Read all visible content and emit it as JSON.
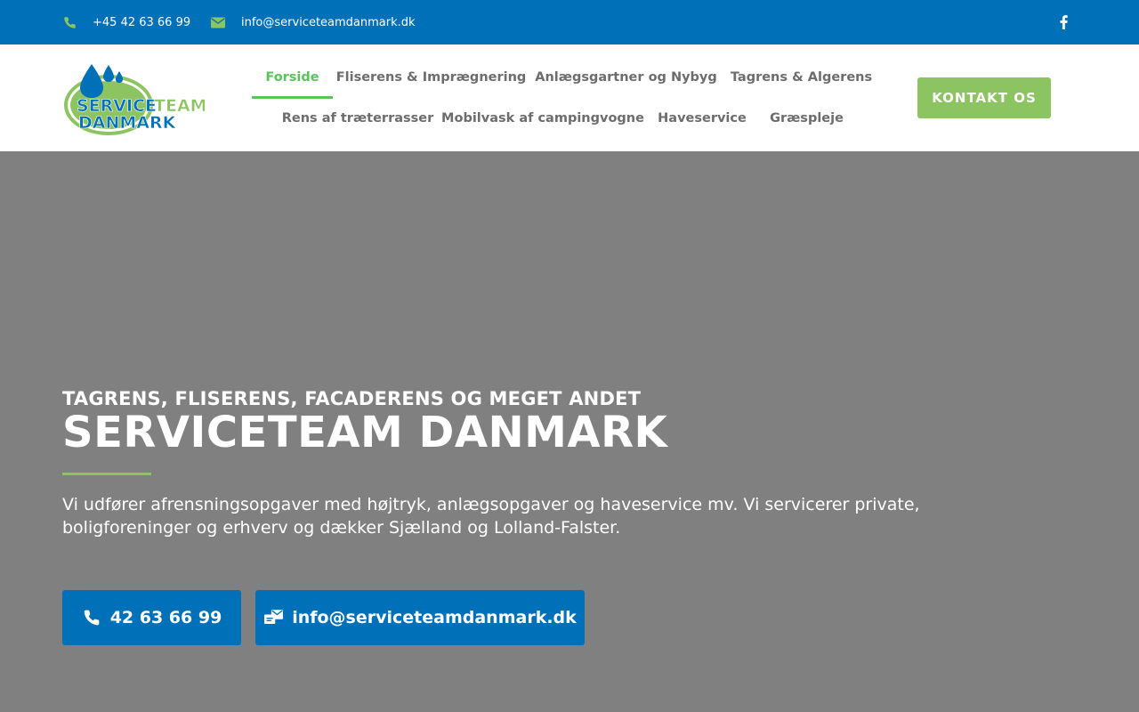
{
  "topbar": {
    "phone": "+45 42 63 66 99",
    "email": "info@serviceteamdanmark.dk",
    "phone_icon": "phone-icon",
    "email_icon": "envelope-icon",
    "social_icon": "facebook-icon"
  },
  "logo": {
    "line1_a": "SERVICE",
    "line1_b": "TEAM",
    "line2": "DANMARK"
  },
  "nav": {
    "items": [
      {
        "label": "Forside",
        "active": true
      },
      {
        "label": "Fliserens & Imprægnering",
        "active": false
      },
      {
        "label": "Anlægsgartner og Nybyg",
        "active": false
      },
      {
        "label": "Tagrens & Algerens",
        "active": false
      },
      {
        "label": "Rens af træterrasser",
        "active": false
      },
      {
        "label": "Mobilvask af campingvogne",
        "active": false
      },
      {
        "label": "Haveservice",
        "active": false
      },
      {
        "label": "Græspleje",
        "active": false
      }
    ],
    "cta_label": "KONTAKT OS"
  },
  "hero": {
    "subtitle": "TAGRENS, FLISERENS, FACADERENS OG MEGET ANDET",
    "title": "SERVICETEAM DANMARK",
    "description": "Vi udfører afrensningsopgaver med højtryk, anlægsopgaver og haveservice mv. Vi servicerer private, boligforeninger og erhverv og dækker Sjælland og Lolland-Falster.",
    "phone_button": "42 63 66 99",
    "email_button": "info@serviceteamdanmark.dk"
  },
  "colors": {
    "brand_blue": "#0070b9",
    "brand_green": "#8dc462",
    "active_green": "#5ac45a",
    "hero_bg": "#808080"
  }
}
